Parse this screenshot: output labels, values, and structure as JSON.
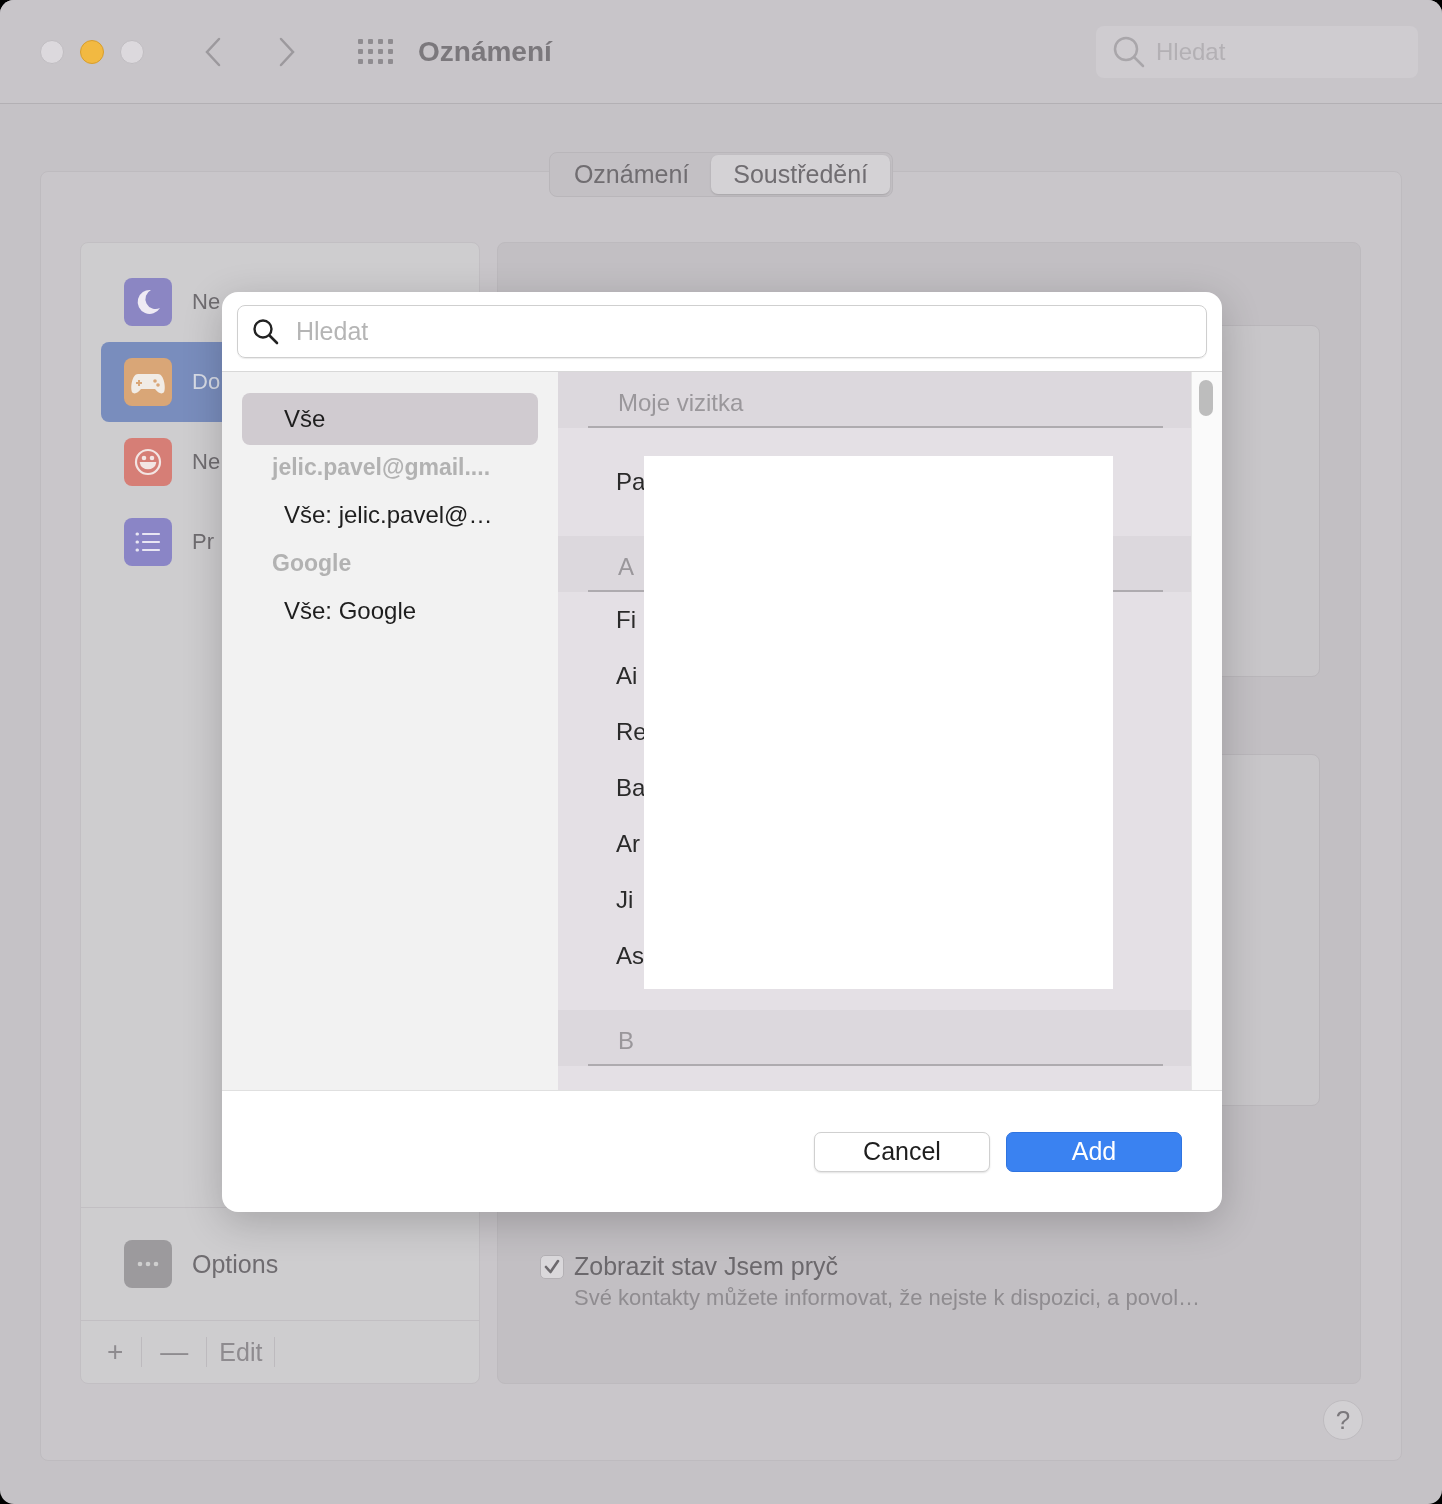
{
  "window": {
    "title": "Oznámení",
    "search_placeholder": "Hledat"
  },
  "tabs": [
    {
      "label": "Oznámení",
      "selected": false
    },
    {
      "label": "Soustředění",
      "selected": true
    }
  ],
  "focus_modes": [
    {
      "label": "Ne",
      "kind": "moon",
      "color": "#8b86c3",
      "selected": false
    },
    {
      "label": "Do",
      "kind": "gamepad",
      "color": "#d9a677",
      "selected": true
    },
    {
      "label": "Ne",
      "kind": "smiley",
      "color": "#d67e76",
      "selected": false
    },
    {
      "label": "Pr",
      "kind": "list",
      "color": "#8a85c6",
      "selected": false
    }
  ],
  "options": {
    "label": "Options"
  },
  "sidebar_footer": {
    "add": "+",
    "remove": "—",
    "edit": "Edit"
  },
  "away_status": {
    "label": "Zobrazit stav Jsem pryč",
    "description": "Své kontakty můžete informovat, že nejste k dispozici, a povol…",
    "checked": true
  },
  "help": "?",
  "dialog": {
    "search_placeholder": "Hledat",
    "groups": [
      {
        "kind": "item",
        "label": "Vše",
        "selected": true
      },
      {
        "kind": "header",
        "label": "jelic.pavel@gmail...."
      },
      {
        "kind": "item",
        "label": "Vše: jelic.pavel@…",
        "selected": false
      },
      {
        "kind": "header",
        "label": "Google"
      },
      {
        "kind": "item",
        "label": "Vše: Google",
        "selected": false
      }
    ],
    "sections": [
      {
        "header": "Moje vizitka",
        "rows": [
          "Pa"
        ]
      },
      {
        "header": "A",
        "rows": [
          "Fi",
          "Ai",
          "Re",
          "Ba",
          "Ar",
          "Ji",
          "As"
        ]
      },
      {
        "header": "B"
      }
    ],
    "buttons": [
      {
        "label": "Cancel",
        "kind": "secondary"
      },
      {
        "label": "Add",
        "kind": "primary"
      }
    ]
  }
}
